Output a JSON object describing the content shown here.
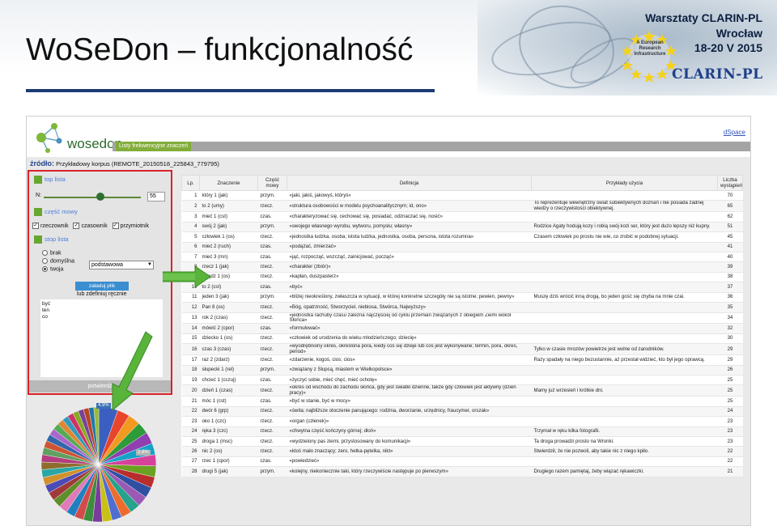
{
  "slide": {
    "title": "WoSeDon – funkcjonalność",
    "workshop_title": "Warsztaty CLARIN-PL",
    "workshop_city": "Wrocław",
    "workshop_date": "18-20 V 2015",
    "clarin_logo": "CLARIN-PL",
    "eu_emblem_text": "A European Research Infrastructure"
  },
  "app": {
    "logo_text": "wosedon",
    "tab_label": "Listy frekwencyjne znaczeń",
    "dspace_link": "dSpace",
    "source_label": "źródło:",
    "source_value": "Przykładowy korpus (REMOTE_20150518_225843_779795)"
  },
  "left_panel": {
    "top_list_label": "top lista",
    "n_label": "N:",
    "n_value": "55",
    "pos_label": "część mowy",
    "checkboxes": [
      {
        "label": "rzeczownik",
        "checked": true
      },
      {
        "label": "czasownik",
        "checked": true
      },
      {
        "label": "przymiotnik",
        "checked": true
      }
    ],
    "stoplist_label": "stop lista",
    "radios": [
      {
        "label": "brak",
        "selected": false
      },
      {
        "label": "domyślna",
        "selected": false
      },
      {
        "label": "twoja",
        "selected": true
      }
    ],
    "select_value": "podstawowa",
    "upload_button": "załaduj plik",
    "custom_label": "lub zdefiniuj ręcznie",
    "stoplist_text": "być\nten\nco",
    "apply_button": "potwierdź"
  },
  "table": {
    "columns": [
      "Lp.",
      "Znaczenie",
      "Część mowy",
      "Definicja",
      "Przykłady użycia",
      "Liczba wystąpień"
    ],
    "rows": [
      [
        "1",
        "który 1 (jak)",
        "przym.",
        "«jaki, jakiś, jakowyś, któryś»",
        "",
        "70"
      ],
      [
        "2",
        "to 2 (umy)",
        "rzecz.",
        "«struktura osobowości w modelu psychoanalitycznym; id, ono»",
        "To reprezentuje wewnętrzny świat subiektywnych doznań i nie posiada żadnej wiedzy o rzeczywistości obiektywnej.",
        "65"
      ],
      [
        "3",
        "mieć 1 (cst)",
        "czas.",
        "«charakteryzować się, cechować się, posiadać, odznaczać się, nosić»",
        "",
        "62"
      ],
      [
        "4",
        "swój 2 (jak)",
        "przym.",
        "«swojego własnego wyrobu, wytworu, pomysłu; własny»",
        "Rodzice Agaty hodują kozy i robią swój kozi ser, który jest dużo lepszy niż kupny.",
        "51"
      ],
      [
        "5",
        "człowiek 1 (os)",
        "rzecz.",
        "«jednostka ludzka, osoba; istota ludzka, jednostka, osoba, persona, istota rozumna»",
        "Czasem człowiek po prostu nie wie, co zrobić w podobnej sytuacji.",
        "45"
      ],
      [
        "6",
        "mieć 2 (ruch)",
        "czas.",
        "«podążać, zmierzać»",
        "",
        "41"
      ],
      [
        "7",
        "mieć 3 (mn)",
        "czas.",
        "«jąć, rozpocząć, wszcząć, zainicjować, począć»",
        "",
        "40"
      ],
      [
        "8",
        "rzecz 1 (jak)",
        "rzecz.",
        "«charakter (zbiór)»",
        "",
        "39"
      ],
      [
        "9",
        "ksiądz 1 (os)",
        "rzecz.",
        "«kapłan, duszpasterz»",
        "",
        "38"
      ],
      [
        "10",
        "to 2 (cst)",
        "czas.",
        "«być»",
        "",
        "37"
      ],
      [
        "11",
        "jeden 3 (jak)",
        "przym.",
        "«bliżej nieokreślony, zwłaszcza w sytuacji, w której konkretne szczegóły nie są istotne; pewien, pewny»",
        "Muszę dziś wrócić inną drogą, bo jeden gość się chyba na mnie czai.",
        "36"
      ],
      [
        "12",
        "Pan 8 (os)",
        "rzecz.",
        "«Bóg, opatrzność, Stworzyciel, niebiosa, Stwórca, Najwyższy»",
        "",
        "35"
      ],
      [
        "13",
        "rok 2 (czas)",
        "rzecz.",
        "«jednostka rachuby czasu zależna najczęściej od cyklu przemian związanych z obiegiem Ziemi wokół Słońca»",
        "",
        "34"
      ],
      [
        "14",
        "mówić 2 (cpor)",
        "czas.",
        "«formułować»",
        "",
        "32"
      ],
      [
        "15",
        "dziecko 1 (os)",
        "rzecz.",
        "«człowiek od urodzenia do wieku młodzieńczego; dziecię»",
        "",
        "30"
      ],
      [
        "16",
        "czas 3 (czas)",
        "rzecz.",
        "«wyodrębniony okres, określona pora, kiedy coś się dzieje lub coś jest wykonywane; termin, pora, okres, period»",
        "Tylko w czasie mrozów powietrze jest wolne od zarodników.",
        "29"
      ],
      [
        "17",
        "raz 2 (zdarz)",
        "rzecz.",
        "«zdarzenie, kogoś, cios; cios»",
        "Razy spadały na niego bezustannie, aż przestał widzieć, kto był jego oprawcą.",
        "29"
      ],
      [
        "18",
        "słupecki 1 (rel)",
        "przym.",
        "«związany z Słupcą, miastem w Wielkopolsce»",
        "",
        "26"
      ],
      [
        "19",
        "chcieć 1 (cczuj)",
        "czas.",
        "«życzyć sobie, mieć chęć, mieć ochotę»",
        "",
        "25"
      ],
      [
        "20",
        "dzień 1 (czas)",
        "rzecz.",
        "«okres od wschodu do zachodu słońca, gdy jest światło dzienne, także gdy człowiek jest aktywny (dzień pracy)»",
        "Mamy już wrzesień i krótkie dni.",
        "25"
      ],
      [
        "21",
        "móc 1 (cst)",
        "czas.",
        "«być w stanie, być w mocy»",
        "",
        "25"
      ],
      [
        "22",
        "dwór 6 (grp)",
        "rzecz.",
        "«świta; najbliższe otoczenie panującego: rodzina, dworzanie, urzędnicy, fraucymer, orszak»",
        "",
        "24"
      ],
      [
        "23",
        "oko 1 (czc)",
        "rzecz.",
        "«organ (człenek)»",
        "",
        "23"
      ],
      [
        "24",
        "ręka 3 (czc)",
        "rzecz.",
        "«chwytna część kończyny górnej; dłoń»",
        "Trzymał w ręku kilka fotografii.",
        "23"
      ],
      [
        "25",
        "droga 1 (msc)",
        "rzecz.",
        "«wydzielony pas ziemi, przystosowany do komunikacji»",
        "Ta droga prowadzi prosto na Wronki.",
        "23"
      ],
      [
        "26",
        "nic 2 (os)",
        "rzecz.",
        "«ktoś mało znaczący; zero, hetka-pętelka, nikt»",
        "Stwierdził, że nie pozwoli, aby takie nic z niego kpiło.",
        "22"
      ],
      [
        "27",
        "rzec 1 (cpor)",
        "czas.",
        "«powiedzieć»",
        "",
        "22"
      ],
      [
        "28",
        "drugi 5 (jak)",
        "przym.",
        "«kolejny, niekoniecznie taki, który rzeczywiście następuje po pierwszym»",
        "Drugiego razem pamiętaj, żeby wiązać rękawiczki.",
        "21"
      ]
    ]
  },
  "pie": {
    "label_1": "4.9%",
    "label_2": "2.8%",
    "slice_colors": [
      "#3b5fc0",
      "#e8452c",
      "#f29a1f",
      "#2d9b3a",
      "#8f3fb0",
      "#14a3c7",
      "#d6419b",
      "#6aa121",
      "#b92d2d",
      "#2f4fa2",
      "#9a5ab4",
      "#27a28d",
      "#ed6c2d",
      "#4e6ed1",
      "#c9c118",
      "#7b3a9e",
      "#3c8e3c",
      "#d24b4b",
      "#1f7fbf",
      "#e07ab8",
      "#5f8f2a",
      "#a03a3a",
      "#4b4bb8",
      "#d0902a",
      "#2aa6a6",
      "#8c6d2d",
      "#b33c7e",
      "#60a060",
      "#cc5533",
      "#3366aa",
      "#aa66cc",
      "#55aa55",
      "#dd8833",
      "#3399bb",
      "#cc3366",
      "#88aa22",
      "#774499",
      "#bb4422",
      "#2277aa",
      "#99bb33"
    ]
  }
}
